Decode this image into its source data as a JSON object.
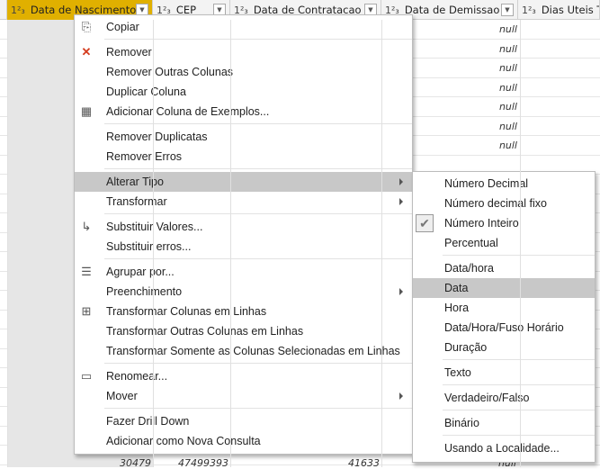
{
  "columns": [
    {
      "type": "1²₃",
      "label": "Data de Nascimento",
      "selected": true
    },
    {
      "type": "1²₃",
      "label": "CEP"
    },
    {
      "type": "1²₃",
      "label": "Data de Contratacao"
    },
    {
      "type": "1²₃",
      "label": "Data de Demissao"
    },
    {
      "type": "1²₃",
      "label": "Dias Uteis Tr"
    }
  ],
  "visible_cells": {
    "null_label": "null",
    "last_row": {
      "nascimento": "30479",
      "cep": "47499393",
      "contratacao": "41633",
      "demissao": "null"
    }
  },
  "context_menu": [
    {
      "label": "Copiar",
      "icon": "copy-icon"
    },
    "sep",
    {
      "label": "Remover",
      "icon": "remove-column-icon"
    },
    {
      "label": "Remover Outras Colunas"
    },
    {
      "label": "Duplicar Coluna"
    },
    {
      "label": "Adicionar Coluna de Exemplos...",
      "icon": "column-from-examples-icon"
    },
    "sep",
    {
      "label": "Remover Duplicatas"
    },
    {
      "label": "Remover Erros"
    },
    "sep",
    {
      "label": "Alterar Tipo",
      "submenu": true,
      "highlighted": true
    },
    {
      "label": "Transformar",
      "submenu": true
    },
    "sep",
    {
      "label": "Substituir Valores...",
      "icon": "replace-values-icon"
    },
    {
      "label": "Substituir erros..."
    },
    "sep",
    {
      "label": "Agrupar por...",
      "icon": "group-by-icon"
    },
    {
      "label": "Preenchimento",
      "submenu": true
    },
    {
      "label": "Transformar Colunas em Linhas",
      "icon": "unpivot-icon"
    },
    {
      "label": "Transformar Outras Colunas em Linhas"
    },
    {
      "label": "Transformar Somente as Colunas Selecionadas em Linhas"
    },
    "sep",
    {
      "label": "Renomear...",
      "icon": "rename-icon"
    },
    {
      "label": "Mover",
      "submenu": true
    },
    "sep",
    {
      "label": "Fazer Drill Down"
    },
    {
      "label": "Adicionar como Nova Consulta"
    }
  ],
  "type_submenu": [
    {
      "label": "Número Decimal"
    },
    {
      "label": "Número decimal fixo"
    },
    {
      "label": "Número Inteiro",
      "checked": true
    },
    {
      "label": "Percentual"
    },
    "sep",
    {
      "label": "Data/hora"
    },
    {
      "label": "Data",
      "highlighted": true
    },
    {
      "label": "Hora"
    },
    {
      "label": "Data/Hora/Fuso Horário"
    },
    {
      "label": "Duração"
    },
    "sep",
    {
      "label": "Texto"
    },
    "sep",
    {
      "label": "Verdadeiro/Falso"
    },
    "sep",
    {
      "label": "Binário"
    },
    "sep",
    {
      "label": "Usando a Localidade..."
    }
  ],
  "colors": {
    "selected_header": "#e0b000",
    "highlight": "#c8c8c8",
    "selected_column": "#e6e6e6"
  }
}
